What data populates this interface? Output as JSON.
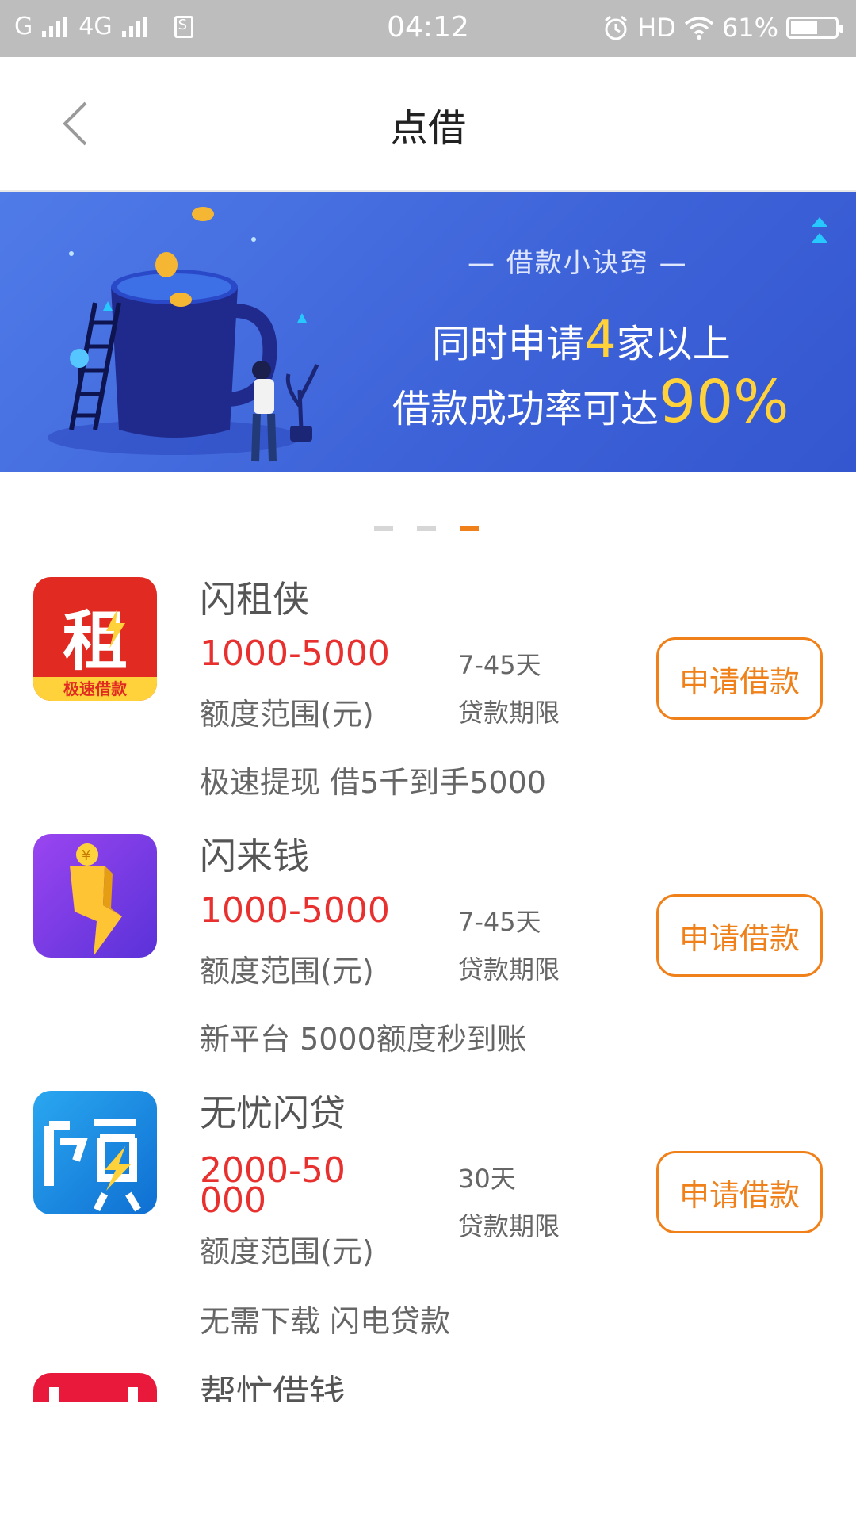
{
  "status_bar": {
    "carrier1": "G",
    "carrier2": "4G",
    "time": "04:12",
    "hd": "HD",
    "battery_text": "61%",
    "battery_level": 0.61
  },
  "nav": {
    "title": "点借",
    "back_icon": "chevron-left-icon"
  },
  "banner": {
    "subtitle": "— 借款小诀窍 —",
    "line1_pre": "同时申请",
    "line1_num": "4",
    "line1_post": "家以上",
    "line2_pre": "借款成功率可达",
    "line2_num": "90%"
  },
  "pager": {
    "count": 3,
    "active": 2
  },
  "loans": [
    {
      "name": "闪租侠",
      "amount": "1000-5000",
      "amount_label": "额度范围(元)",
      "term": "7-45天",
      "term_label": "贷款期限",
      "desc": "极速提现 借5千到手5000",
      "button": "申请借款",
      "logo_char": "租",
      "logo_caption": "极速借款",
      "logo_color": "#e12a22"
    },
    {
      "name": "闪来钱",
      "amount": "1000-5000",
      "amount_label": "额度范围(元)",
      "term": "7-45天",
      "term_label": "贷款期限",
      "desc": "新平台 5000额度秒到账",
      "button": "申请借款",
      "logo_color": "#7b3df0"
    },
    {
      "name": "无忧闪贷",
      "amount": "2000-50000",
      "amount_label": "额度范围(元)",
      "term": "30天",
      "term_label": "贷款期限",
      "desc": "无需下载 闪电贷款",
      "button": "申请借款",
      "logo_color": "#1a86e0"
    },
    {
      "name": "帮忙借钱",
      "logo_color": "#e8193a"
    }
  ],
  "colors": {
    "accent": "#f08019",
    "amount": "#e8312f",
    "banner": "#4169e1"
  }
}
